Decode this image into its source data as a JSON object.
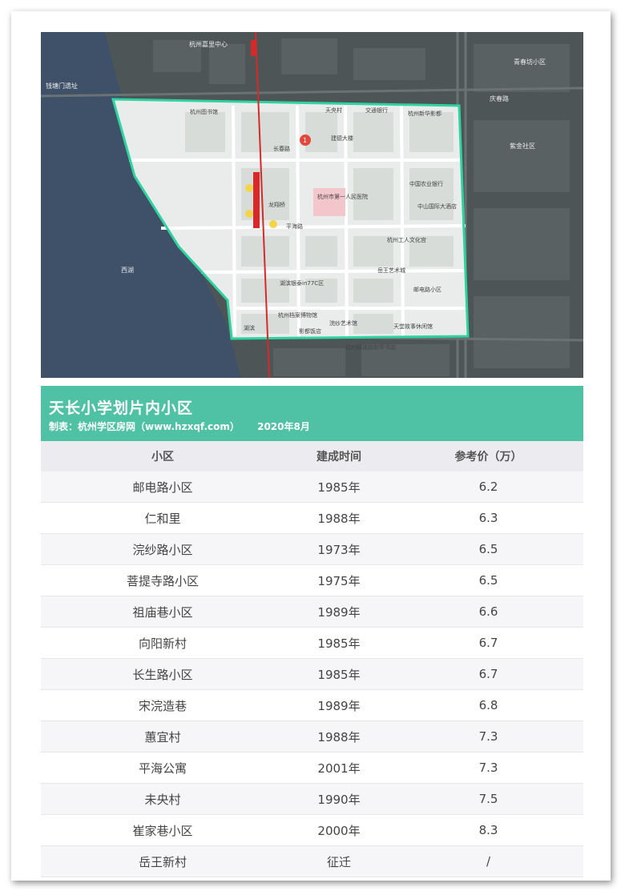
{
  "map": {
    "labels": {
      "top_center": "杭州嘉里中心",
      "left_top": "钱塘门遗址",
      "right_top": "青春坊小区",
      "right_mid": "紫金社区",
      "station": "龙翔桥",
      "road_1": "平海路",
      "road_2": "湖滨",
      "road_3": "庆春路",
      "road_4": "西湖",
      "inner_1": "天央村",
      "inner_2": "杭州新华影都",
      "inner_3": "杭州市第一人民医院",
      "inner_4": "中国农业银行",
      "inner_5": "湖滨银泰in77C区",
      "inner_6": "杭州解放路新华书店",
      "inner_7": "邮电路小区",
      "inner_8": "天堂故事休闲馆",
      "inner_9": "浣纱艺术馆",
      "inner_10": "杭州工人文化宫",
      "inner_11": "岳王艺术城",
      "inner_12": "杭州图书馆",
      "inner_13": "建德大楼",
      "inner_14": "交通银行",
      "inner_15": "长春路",
      "inner_16": "中山国际大酒店",
      "inner_17": "杭州档案博物馆",
      "inner_18": "影都饭店",
      "marker": "1"
    },
    "colors": {
      "boundary": "#2fd3a0",
      "metro": "#d62a2a"
    }
  },
  "header": {
    "title": "天长小学划片内小区",
    "maker": "制表：杭州学区房网（www.hzxqf.com）",
    "date": "2020年8月"
  },
  "table": {
    "columns": [
      "小区",
      "建成时间",
      "参考价（万）"
    ],
    "rows": [
      [
        "邮电路小区",
        "1985年",
        "6.2"
      ],
      [
        "仁和里",
        "1988年",
        "6.3"
      ],
      [
        "浣纱路小区",
        "1973年",
        "6.5"
      ],
      [
        "菩提寺路小区",
        "1975年",
        "6.5"
      ],
      [
        "祖庙巷小区",
        "1989年",
        "6.6"
      ],
      [
        "向阳新村",
        "1985年",
        "6.7"
      ],
      [
        "长生路小区",
        "1985年",
        "6.7"
      ],
      [
        "宋浣造巷",
        "1989年",
        "6.8"
      ],
      [
        "蕙宜村",
        "1988年",
        "7.3"
      ],
      [
        "平海公寓",
        "2001年",
        "7.3"
      ],
      [
        "未央村",
        "1990年",
        "7.5"
      ],
      [
        "崔家巷小区",
        "2000年",
        "8.3"
      ],
      [
        "岳王新村",
        "征迁",
        "/"
      ]
    ]
  }
}
